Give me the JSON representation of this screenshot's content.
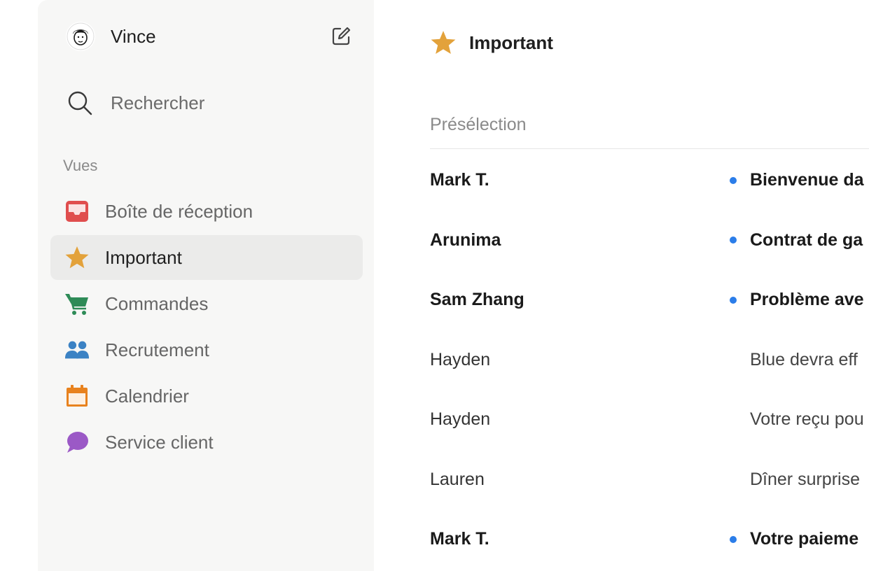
{
  "user": {
    "name": "Vince"
  },
  "search": {
    "label": "Rechercher"
  },
  "views_label": "Vues",
  "nav": [
    {
      "label": "Boîte de réception",
      "icon": "inbox-icon",
      "color": "#e04e4e"
    },
    {
      "label": "Important",
      "icon": "star-icon",
      "color": "#e3a23b",
      "active": true
    },
    {
      "label": "Commandes",
      "icon": "cart-icon",
      "color": "#2e8b57"
    },
    {
      "label": "Recrutement",
      "icon": "people-icon",
      "color": "#3b82c4"
    },
    {
      "label": "Calendrier",
      "icon": "calendar-icon",
      "color": "#e8821e"
    },
    {
      "label": "Service client",
      "icon": "chat-bubble-icon",
      "color": "#9b59c6"
    }
  ],
  "main": {
    "title": "Important",
    "section": "Présélection",
    "messages": [
      {
        "sender": "Mark T.",
        "subject": "Bienvenue da",
        "unread": true
      },
      {
        "sender": "Arunima",
        "subject": "Contrat de ga",
        "unread": true
      },
      {
        "sender": "Sam Zhang",
        "subject": "Problème ave",
        "unread": true
      },
      {
        "sender": "Hayden",
        "subject": "Blue devra eff",
        "unread": false
      },
      {
        "sender": "Hayden",
        "subject": "Votre reçu pou",
        "unread": false
      },
      {
        "sender": "Lauren",
        "subject": "Dîner surprise",
        "unread": false
      },
      {
        "sender": "Mark T.",
        "subject": "Votre paieme",
        "unread": true
      }
    ]
  },
  "colors": {
    "accent_star": "#e3a23b",
    "unread_dot": "#2b7de9",
    "sidebar_bg": "#f7f7f6"
  }
}
